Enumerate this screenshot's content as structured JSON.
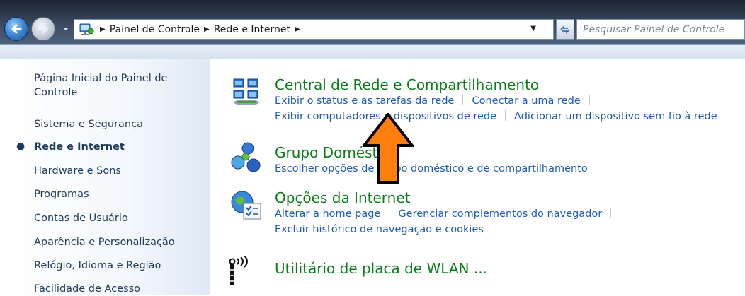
{
  "address_bar": {
    "breadcrumbs": [
      "Painel de Controle",
      "Rede e Internet"
    ],
    "search_placeholder": "Pesquisar Painel de Controle",
    "icons": {
      "back": "back-arrow-icon",
      "forward": "forward-arrow-icon",
      "history": "dropdown-arrow-icon",
      "location": "control-panel-icon",
      "refresh": "refresh-icon"
    }
  },
  "sidebar": {
    "items": [
      {
        "label": "Página Inicial do Painel de",
        "label2": "Controle",
        "current": false
      },
      {
        "label": "Sistema e Segurança",
        "current": false
      },
      {
        "label": "Rede e Internet",
        "current": true
      },
      {
        "label": "Hardware e Sons",
        "current": false
      },
      {
        "label": "Programas",
        "current": false
      },
      {
        "label": "Contas de Usuário",
        "current": false
      },
      {
        "label": "Aparência e Personalização",
        "current": false
      },
      {
        "label": "Relógio, Idioma e Região",
        "current": false
      },
      {
        "label": "Facilidade de Acesso",
        "current": false
      }
    ]
  },
  "categories": [
    {
      "title": "Central de Rede e Compartilhamento",
      "icon": "network-sharing-icon",
      "links": [
        [
          "Exibir o status e as tarefas da rede",
          "Conectar a uma rede"
        ],
        [
          "Exibir computadores e dispositivos de rede",
          "Adicionar um dispositivo sem fio à rede"
        ]
      ]
    },
    {
      "title": "Grupo Doméstico",
      "icon": "homegroup-icon",
      "links": [
        [
          "Escolher opções de grupo doméstico e de compartilhamento"
        ]
      ]
    },
    {
      "title": "Opções da Internet",
      "icon": "internet-options-icon",
      "links": [
        [
          "Alterar a home page",
          "Gerenciar complementos do navegador"
        ],
        [
          "Excluir histórico de navegação e cookies"
        ]
      ]
    },
    {
      "title": "Utilitário de placa de WLAN ...",
      "icon": "wlan-utility-icon",
      "links": []
    }
  ],
  "annotation": {
    "icon": "orange-up-arrow-icon",
    "color": "#ff7f0e"
  },
  "colors": {
    "category_title": "#0d7d1c",
    "link": "#1e5bb8",
    "sidebar_text": "#1e395b"
  }
}
